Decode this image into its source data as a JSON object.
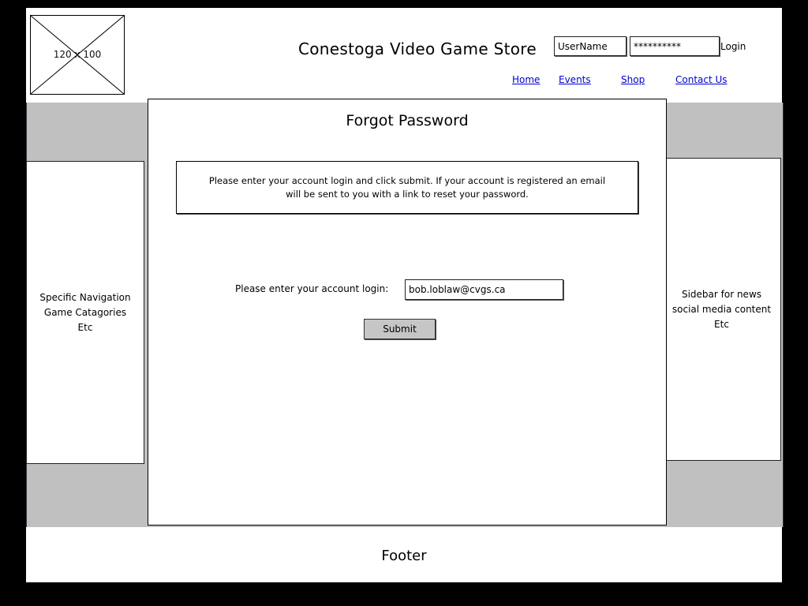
{
  "header": {
    "logo_placeholder": "120 x 100",
    "site_title": "Conestoga Video Game Store",
    "username_value": "UserName",
    "password_value": "**********",
    "login_label": "Login"
  },
  "nav": {
    "items": [
      {
        "label": "Home"
      },
      {
        "label": "Events"
      },
      {
        "label": "Shop"
      },
      {
        "label": "Contact Us"
      }
    ]
  },
  "left_sidebar": {
    "lines": [
      "Specific Navigation",
      "Game Catagories",
      "Etc"
    ]
  },
  "right_sidebar": {
    "lines": [
      "Sidebar for news",
      "social media content",
      "Etc"
    ]
  },
  "main": {
    "title": "Forgot Password",
    "instructions": "Please enter your account login and click submit. If your account is registered an email will be sent to you with a link to reset your password.",
    "field_label": "Please enter your account login:",
    "login_value": "bob.loblaw@cvgs.ca",
    "submit_label": "Submit"
  },
  "footer": {
    "label": "Footer"
  }
}
